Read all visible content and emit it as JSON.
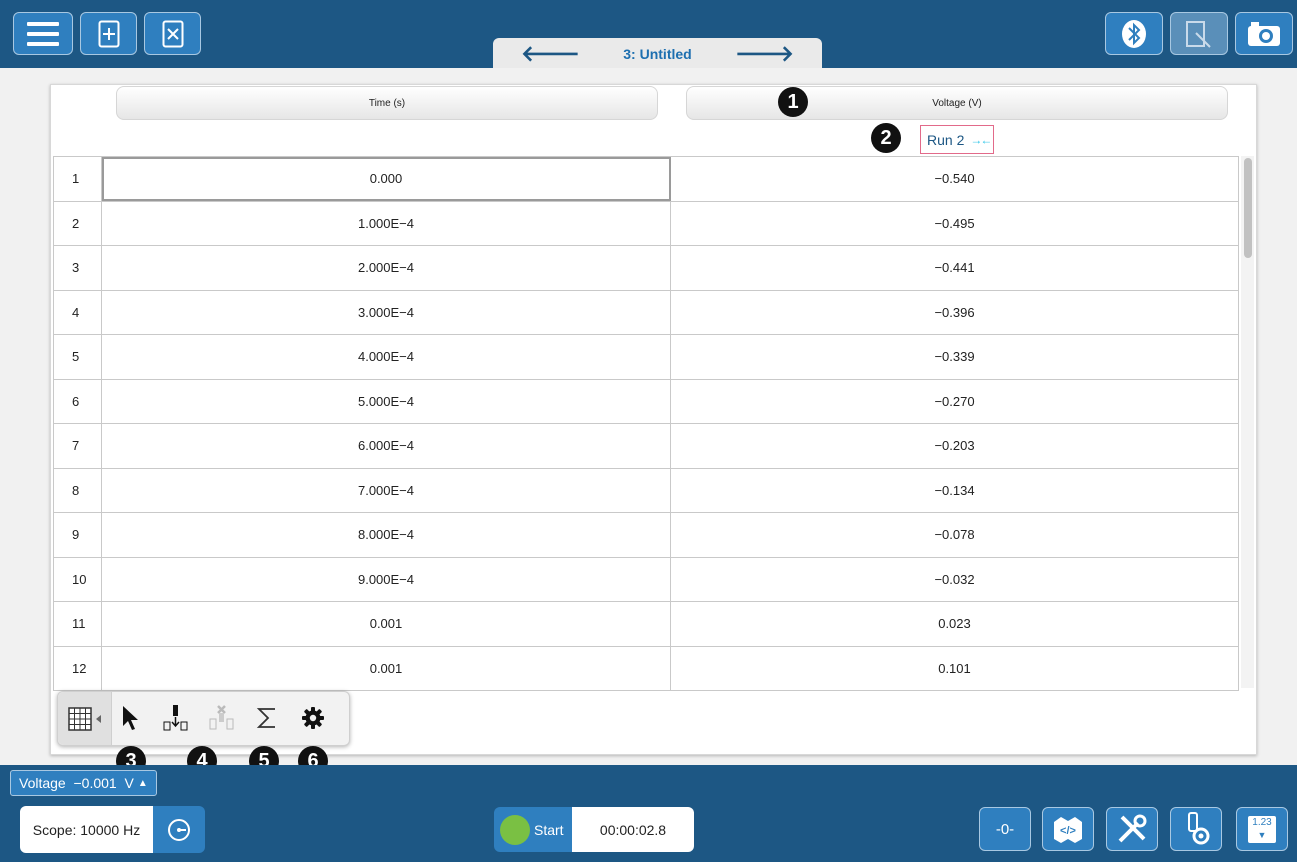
{
  "header": {
    "tab_title": "3: Untitled",
    "prev_arrow": "🡐",
    "next_arrow": "🡒"
  },
  "table": {
    "columns": [
      "Time (s)",
      "Voltage (V)"
    ],
    "run_label": "Run 2",
    "run_symbol": "✦",
    "rows": [
      {
        "index": "1",
        "time": "0.000",
        "voltage": "−0.540"
      },
      {
        "index": "2",
        "time": "1.000E−4",
        "voltage": "−0.495"
      },
      {
        "index": "3",
        "time": "2.000E−4",
        "voltage": "−0.441"
      },
      {
        "index": "4",
        "time": "3.000E−4",
        "voltage": "−0.396"
      },
      {
        "index": "5",
        "time": "4.000E−4",
        "voltage": "−0.339"
      },
      {
        "index": "6",
        "time": "5.000E−4",
        "voltage": "−0.270"
      },
      {
        "index": "7",
        "time": "6.000E−4",
        "voltage": "−0.203"
      },
      {
        "index": "8",
        "time": "7.000E−4",
        "voltage": "−0.134"
      },
      {
        "index": "9",
        "time": "8.000E−4",
        "voltage": "−0.078"
      },
      {
        "index": "10",
        "time": "9.000E−4",
        "voltage": "−0.032"
      },
      {
        "index": "11",
        "time": "0.001",
        "voltage": "0.023"
      },
      {
        "index": "12",
        "time": "0.001",
        "voltage": "0.101"
      }
    ]
  },
  "callouts": [
    "1",
    "2",
    "3",
    "4",
    "5",
    "6"
  ],
  "sensor": {
    "readout": "Voltage  −0.001  V"
  },
  "bottom": {
    "scope_label": "Scope: 10000 Hz",
    "start_label": "Start",
    "elapsed": "00:00:02.8",
    "zero_label": "-0-",
    "meter_label": "1.23"
  },
  "icons": {
    "menu": "menu-icon",
    "new_page": "add-page-icon",
    "delete_page": "delete-page-icon",
    "bluetooth": "bluetooth-icon",
    "annotate": "annotation-icon",
    "camera": "camera-icon",
    "table_tool": "table-icon",
    "select": "select-pointer-icon",
    "insert_row": "insert-row-icon",
    "delete_row": "delete-row-icon",
    "statistics": "sigma-icon",
    "settings": "gear-icon"
  },
  "colors": {
    "header": "#1d5784",
    "button": "#2f7fbf",
    "run_border": "#e26a8a",
    "start_dot": "#7ac043"
  }
}
